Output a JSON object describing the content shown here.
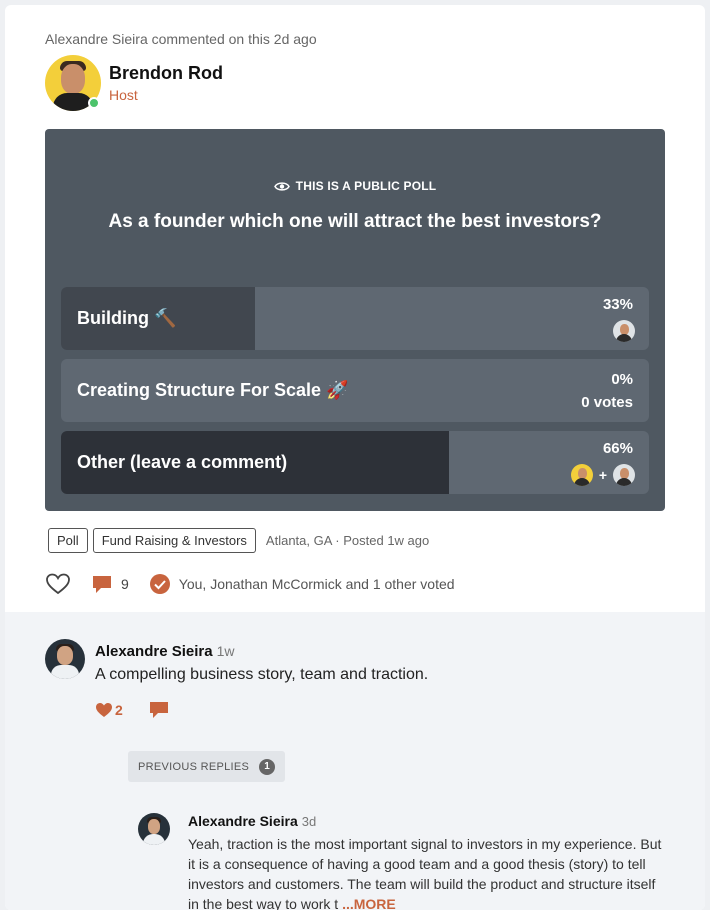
{
  "post": {
    "activity": "Alexandre Sieira commented on this 2d ago",
    "author_name": "Brendon Rod",
    "author_role": "Host"
  },
  "poll": {
    "public_label": "THIS IS A PUBLIC POLL",
    "question": "As a founder which one will attract the best investors?",
    "options": [
      {
        "label": "Building 🔨",
        "percent": "33%",
        "votes": "",
        "fill": 0.33
      },
      {
        "label": "Creating Structure For Scale 🚀",
        "percent": "0%",
        "votes": "0 votes",
        "fill": 0
      },
      {
        "label": "Other (leave a comment)",
        "percent": "66%",
        "votes": "",
        "fill": 0.66
      }
    ],
    "plus": "+"
  },
  "tags": [
    "Poll",
    "Fund Raising & Investors"
  ],
  "meta": "Atlanta, GA · Posted 1w ago",
  "actions": {
    "comment_count": "9",
    "voted_text": "You, Jonathan McCormick and 1 other voted"
  },
  "comments": [
    {
      "name": "Alexandre Sieira",
      "time": "1w",
      "text": "A compelling business story, team and traction.",
      "likes": "2"
    }
  ],
  "previous_replies": {
    "label": "PREVIOUS REPLIES",
    "count": "1"
  },
  "reply": {
    "name": "Alexandre Sieira",
    "time": "3d",
    "text": "Yeah, traction is the most important signal to investors in my experience. But it is a consequence of having a good team and a good thesis (story) to tell investors and customers. The team will build the product and structure itself in the best way to work t ",
    "more": "...MORE"
  },
  "colors": {
    "accent": "#c8643e",
    "poll_bg": "#4f5861",
    "online": "#4cc36b"
  }
}
